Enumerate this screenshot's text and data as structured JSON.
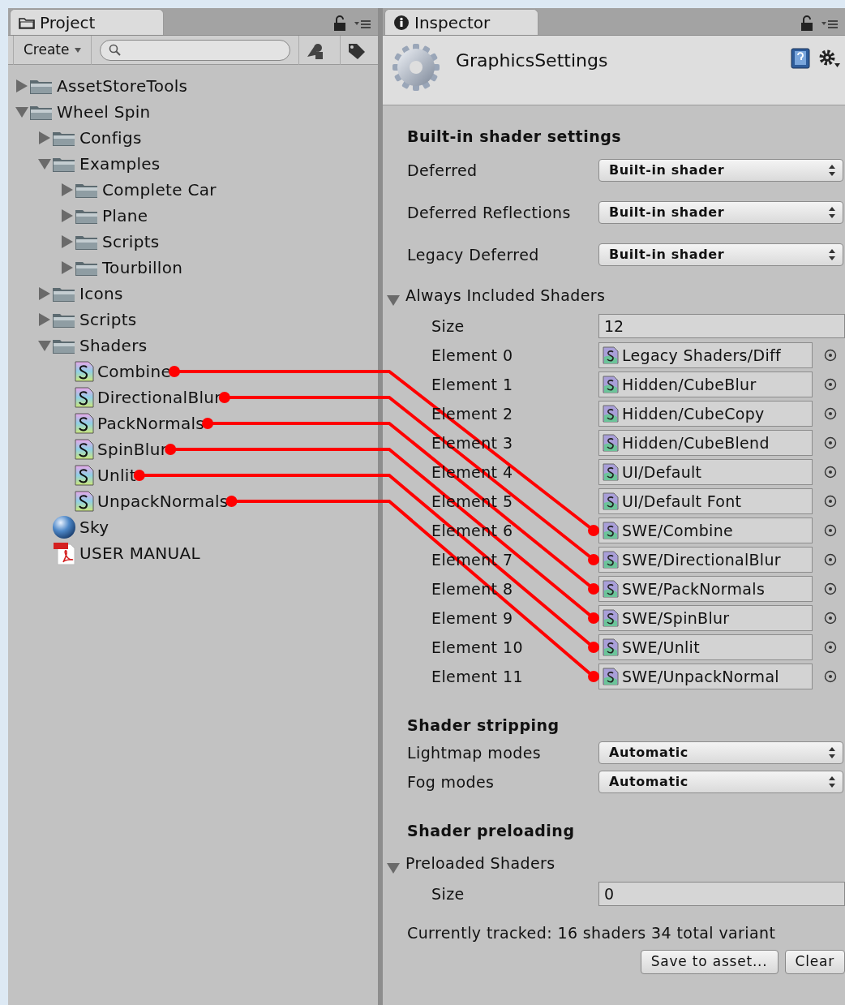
{
  "project": {
    "tab": "Project",
    "create_button": "Create",
    "tree": [
      {
        "label": "AssetStoreTools",
        "kind": "folder",
        "expanded": false
      },
      {
        "label": "Wheel Spin",
        "kind": "folder",
        "expanded": true,
        "children": [
          {
            "label": "Configs",
            "kind": "folder",
            "expanded": false
          },
          {
            "label": "Examples",
            "kind": "folder",
            "expanded": true,
            "children": [
              {
                "label": "Complete Car",
                "kind": "folder",
                "expanded": false
              },
              {
                "label": "Plane",
                "kind": "folder",
                "expanded": false
              },
              {
                "label": "Scripts",
                "kind": "folder",
                "expanded": false
              },
              {
                "label": "Tourbillon",
                "kind": "folder",
                "expanded": false
              }
            ]
          },
          {
            "label": "Icons",
            "kind": "folder",
            "expanded": false
          },
          {
            "label": "Scripts",
            "kind": "folder",
            "expanded": false
          },
          {
            "label": "Shaders",
            "kind": "folder",
            "expanded": true,
            "children": [
              {
                "label": "Combine",
                "kind": "shader",
                "linked": true
              },
              {
                "label": "DirectionalBlur",
                "kind": "shader",
                "linked": true
              },
              {
                "label": "PackNormals",
                "kind": "shader",
                "linked": true
              },
              {
                "label": "SpinBlur",
                "kind": "shader",
                "linked": true
              },
              {
                "label": "Unlit",
                "kind": "shader",
                "linked": true
              },
              {
                "label": "UnpackNormals",
                "kind": "shader",
                "linked": true
              }
            ]
          },
          {
            "label": "Sky",
            "kind": "material"
          },
          {
            "label": "USER MANUAL",
            "kind": "pdf"
          }
        ]
      }
    ]
  },
  "inspector": {
    "tab": "Inspector",
    "title": "GraphicsSettings",
    "sections": [
      {
        "heading": "Built-in shader settings",
        "rows": [
          {
            "kind": "dropdown",
            "label": "Deferred",
            "value": "Built-in shader"
          },
          {
            "kind": "dropdown",
            "label": "Deferred Reflections",
            "value": "Built-in shader"
          },
          {
            "kind": "dropdown",
            "label": "Legacy Deferred",
            "value": "Built-in shader"
          },
          {
            "kind": "list",
            "label": "Always Included Shaders",
            "expanded": true,
            "size_label": "Size",
            "size": "12",
            "elements": [
              {
                "label": "Element 0",
                "value": "Legacy Shaders/Diff",
                "linked": false
              },
              {
                "label": "Element 1",
                "value": "Hidden/CubeBlur",
                "linked": false
              },
              {
                "label": "Element 2",
                "value": "Hidden/CubeCopy",
                "linked": false
              },
              {
                "label": "Element 3",
                "value": "Hidden/CubeBlend",
                "linked": false
              },
              {
                "label": "Element 4",
                "value": "UI/Default",
                "linked": false
              },
              {
                "label": "Element 5",
                "value": "UI/Default Font",
                "linked": false
              },
              {
                "label": "Element 6",
                "value": "SWE/Combine",
                "linked": true
              },
              {
                "label": "Element 7",
                "value": "SWE/DirectionalBlur",
                "linked": true
              },
              {
                "label": "Element 8",
                "value": "SWE/PackNormals",
                "linked": true
              },
              {
                "label": "Element 9",
                "value": "SWE/SpinBlur",
                "linked": true
              },
              {
                "label": "Element 10",
                "value": "SWE/Unlit",
                "linked": true
              },
              {
                "label": "Element 11",
                "value": "SWE/UnpackNormal",
                "linked": true
              }
            ]
          }
        ]
      },
      {
        "heading": "Shader stripping",
        "rows": [
          {
            "kind": "dropdown",
            "label": "Lightmap modes",
            "value": "Automatic"
          },
          {
            "kind": "dropdown",
            "label": "Fog modes",
            "value": "Automatic"
          }
        ]
      },
      {
        "heading": "Shader preloading",
        "rows": [
          {
            "kind": "list",
            "label": "Preloaded Shaders",
            "expanded": true,
            "size_label": "Size",
            "size": "0"
          }
        ]
      }
    ],
    "tracked": "Currently tracked: 16 shaders 34 total variant",
    "buttons": [
      "Save to asset...",
      "Clear"
    ]
  }
}
